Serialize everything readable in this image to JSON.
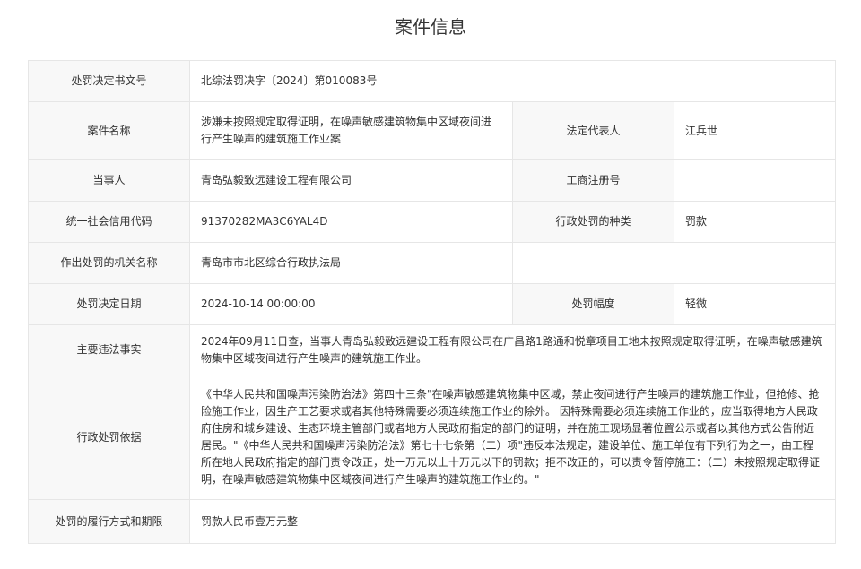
{
  "page": {
    "title": "案件信息"
  },
  "rows": {
    "decision_no": {
      "label": "处罚决定书文号",
      "value": "北综法罚决字〔2024〕第010083号"
    },
    "case_name": {
      "label": "案件名称",
      "value": "涉嫌未按照规定取得证明，在噪声敏感建筑物集中区域夜间进行产生噪声的建筑施工作业案"
    },
    "legal_rep": {
      "label": "法定代表人",
      "value": "江兵世"
    },
    "party": {
      "label": "当事人",
      "value": "青岛弘毅致远建设工程有限公司"
    },
    "business_reg": {
      "label": "工商注册号",
      "value": ""
    },
    "credit_code": {
      "label": "统一社会信用代码",
      "value": "91370282MA3C6YAL4D"
    },
    "penalty_type": {
      "label": "行政处罚的种类",
      "value": "罚款"
    },
    "authority": {
      "label": "作出处罚的机关名称",
      "value": "青岛市市北区综合行政执法局"
    },
    "decision_date": {
      "label": "处罚决定日期",
      "value": "2024-10-14 00:00:00"
    },
    "penalty_range": {
      "label": "处罚幅度",
      "value": "轻微"
    },
    "violation_facts": {
      "label": "主要违法事实",
      "value": "2024年09月11日查，当事人青岛弘毅致远建设工程有限公司在广昌路1路通和悦章项目工地未按照规定取得证明，在噪声敏感建筑物集中区域夜间进行产生噪声的建筑施工作业。"
    },
    "legal_basis": {
      "label": "行政处罚依据",
      "value": "《中华人民共和国噪声污染防治法》第四十三条\"在噪声敏感建筑物集中区域，禁止夜间进行产生噪声的建筑施工作业，但抢修、抢险施工作业，因生产工艺要求或者其他特殊需要必须连续施工作业的除外。 因特殊需要必须连续施工作业的，应当取得地方人民政府住房和城乡建设、生态环境主管部门或者地方人民政府指定的部门的证明，并在施工现场显著位置公示或者以其他方式公告附近居民。\"《中华人民共和国噪声污染防治法》第七十七条第（二）项\"违反本法规定，建设单位、施工单位有下列行为之一，由工程所在地人民政府指定的部门责令改正，处一万元以上十万元以下的罚款；拒不改正的，可以责令暂停施工：（二）未按照规定取得证明，在噪声敏感建筑物集中区域夜间进行产生噪声的建筑施工作业的。\""
    },
    "performance": {
      "label": "处罚的履行方式和期限",
      "value": "罚款人民币壹万元整"
    }
  }
}
